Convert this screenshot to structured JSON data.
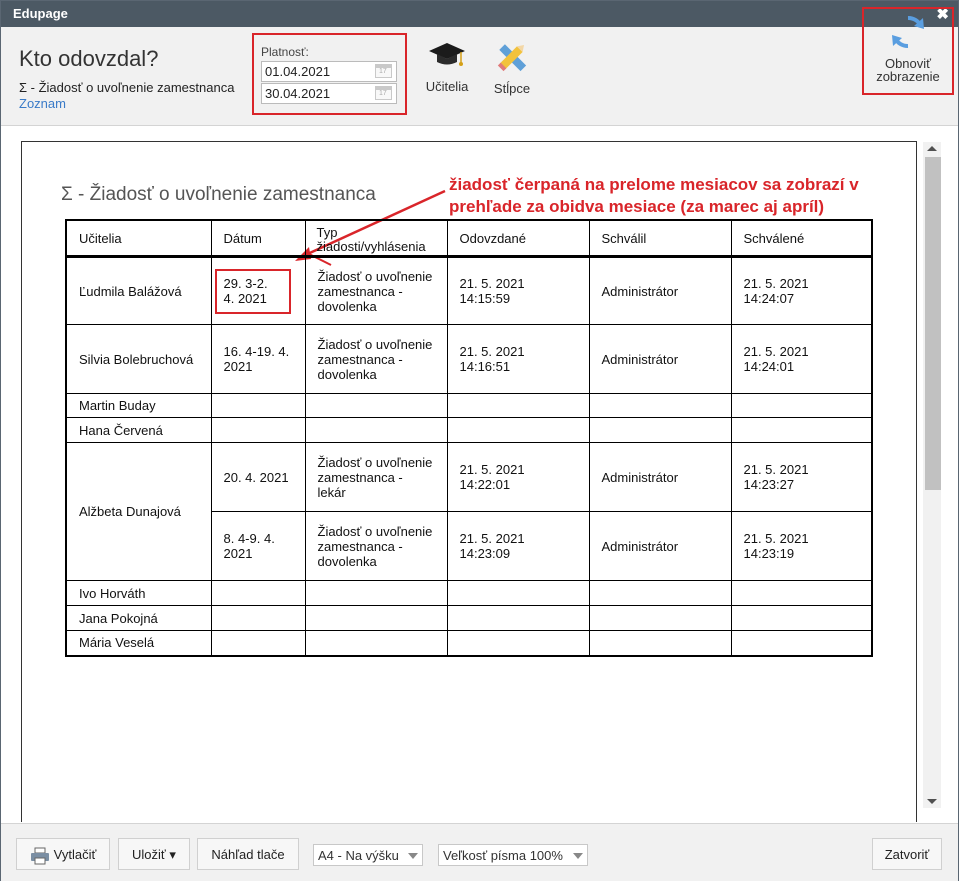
{
  "window": {
    "title": "Edupage",
    "close_symbol": "✖"
  },
  "header": {
    "heading": "Kto odovzdal?",
    "subtitle": "Σ - Žiadosť o uvoľnenie zamestnanca",
    "link": "Zoznam",
    "validity_label": "Platnosť:",
    "date_from": "01.04.2021",
    "date_to": "30.04.2021",
    "teachers_label": "Učitelia",
    "columns_label": "Stĺpce",
    "refresh_label_line1": "Obnoviť",
    "refresh_label_line2": "zobrazenie"
  },
  "document": {
    "title": "Σ - Žiadosť o uvoľnenie zamestnanca",
    "annotation": "žiadosť čerpaná na prelome mesiacov sa zobrazí v prehľade za obidva mesiace (za marec aj apríl)",
    "columns": [
      "Učitelia",
      "Dátum",
      "Typ žiadosti/vyhlásenia",
      "Odovzdané",
      "Schválil",
      "Schválené"
    ],
    "rows": [
      {
        "teacher": "Ľudmila Balážová",
        "date": "29. 3-2. 4. 2021",
        "type": "Žiadosť o uvoľnenie zamestnanca - dovolenka",
        "submitted": "21. 5. 2021 14:15:59",
        "approver": "Administrátor",
        "approved": "21. 5. 2021 14:24:07"
      },
      {
        "teacher": "Silvia Bolebruchová",
        "date": "16. 4-19. 4. 2021",
        "type": "Žiadosť o uvoľnenie zamestnanca - dovolenka",
        "submitted": "21. 5. 2021 14:16:51",
        "approver": "Administrátor",
        "approved": "21. 5. 2021 14:24:01"
      },
      {
        "teacher": "Martin Buday"
      },
      {
        "teacher": "Hana Červená"
      },
      {
        "teacher": "Alžbeta Dunajová",
        "date": "20. 4. 2021",
        "type": "Žiadosť o uvoľnenie zamestnanca - lekár",
        "submitted": "21. 5. 2021 14:22:01",
        "approver": "Administrátor",
        "approved": "21. 5. 2021 14:23:27"
      },
      {
        "teacher": "",
        "date": "8. 4-9. 4. 2021",
        "type": "Žiadosť o uvoľnenie zamestnanca - dovolenka",
        "submitted": "21. 5. 2021 14:23:09",
        "approver": "Administrátor",
        "approved": "21. 5. 2021 14:23:19"
      },
      {
        "teacher": "Ivo Horváth"
      },
      {
        "teacher": "Jana Pokojná"
      },
      {
        "teacher": "Mária Veselá"
      }
    ]
  },
  "footer": {
    "print_label": "Vytlačiť",
    "save_label": "Uložiť ▾",
    "preview_label": "Náhľad tlače",
    "paper_select": "A4 - Na výšku",
    "font_select": "Veľkosť písma 100%",
    "close_label": "Zatvoriť"
  },
  "colors": {
    "accent_red": "#d9252a",
    "titlebar": "#4c5964",
    "link": "#3a7bc8"
  }
}
